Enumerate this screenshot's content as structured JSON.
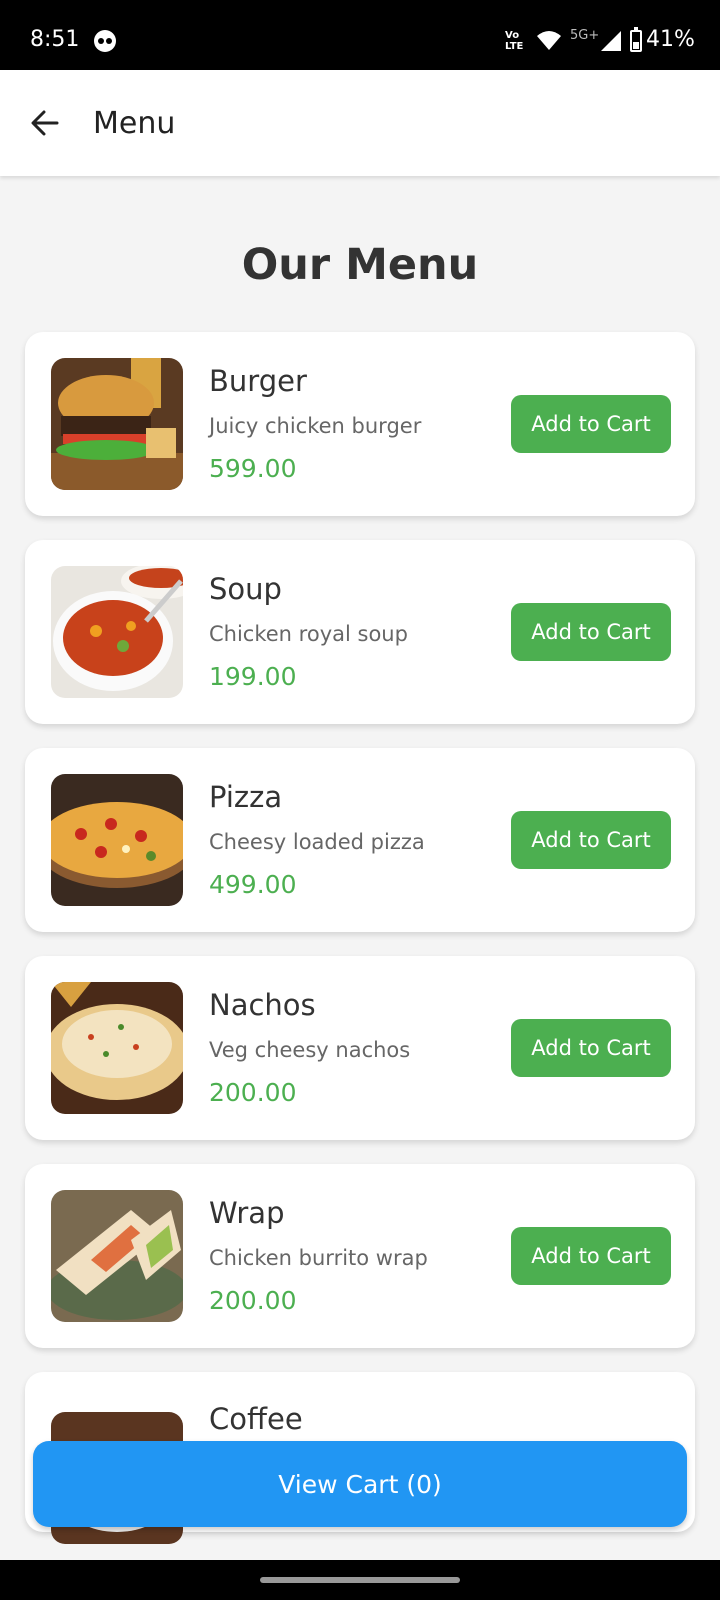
{
  "status_bar": {
    "time": "8:51",
    "network": "5G+",
    "volte": "Vo LTE",
    "battery_pct": "41%",
    "battery_level": 0.41
  },
  "app_bar": {
    "title": "Menu",
    "back_icon": "arrow-left-icon"
  },
  "heading": "Our Menu",
  "menu_items": [
    {
      "name": "Burger",
      "description": "Juicy chicken burger",
      "price": "599.00",
      "button": "Add to Cart"
    },
    {
      "name": "Soup",
      "description": "Chicken royal soup",
      "price": "199.00",
      "button": "Add to Cart"
    },
    {
      "name": "Pizza",
      "description": "Cheesy loaded pizza",
      "price": "499.00",
      "button": "Add to Cart"
    },
    {
      "name": "Nachos",
      "description": "Veg cheesy nachos",
      "price": "200.00",
      "button": "Add to Cart"
    },
    {
      "name": "Wrap",
      "description": "Chicken burrito wrap",
      "price": "200.00",
      "button": "Add to Cart"
    },
    {
      "name": "Coffee"
    }
  ],
  "view_cart": "View Cart (0)",
  "colors": {
    "accent_green": "#4caf50",
    "cart_blue": "#2196f3",
    "background": "#f4f4f4"
  }
}
